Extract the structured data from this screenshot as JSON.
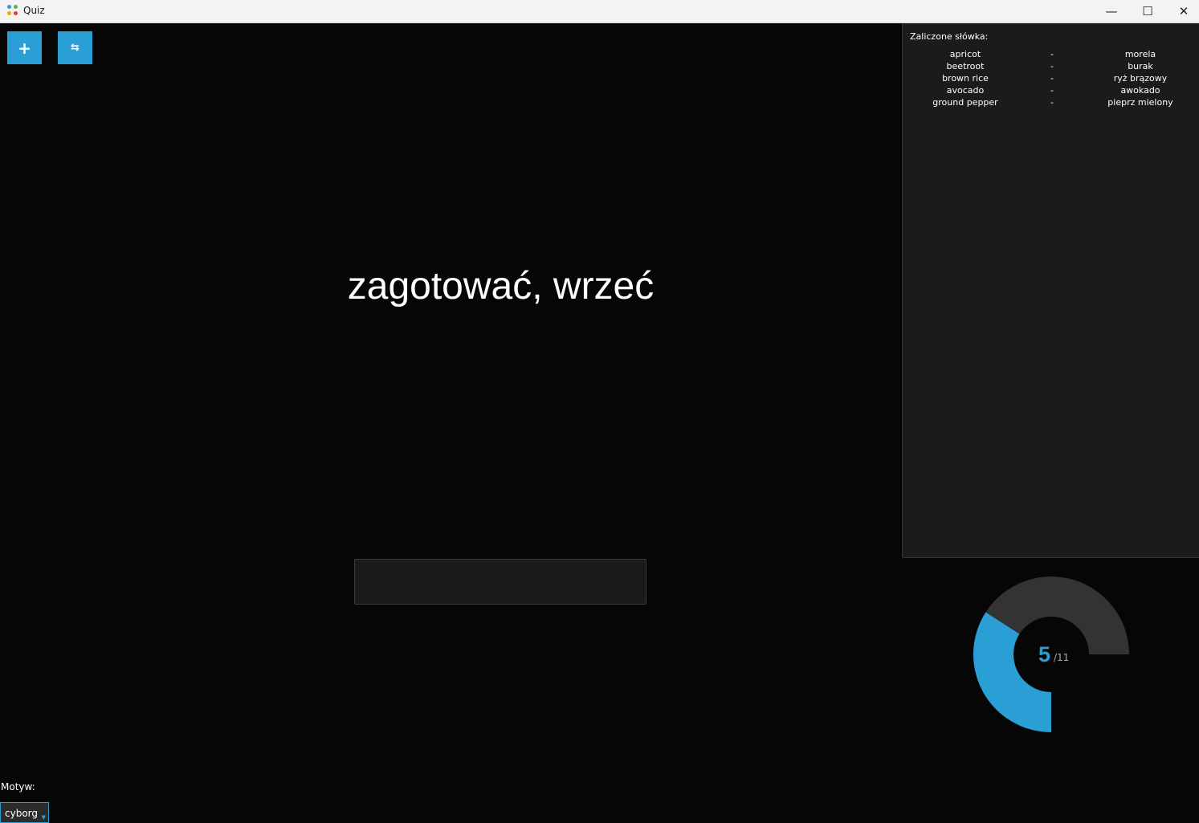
{
  "window": {
    "title": "Quiz",
    "icon": "app-dots-icon",
    "controls": {
      "minimize": "—",
      "maximize": "☐",
      "close": "✕"
    }
  },
  "toolbar": {
    "add_icon": "+",
    "swap_icon": "⇆"
  },
  "quiz": {
    "current_word": "zagotować, wrzeć",
    "answer_value": ""
  },
  "completed": {
    "title": "Zaliczone słówka:",
    "rows": [
      {
        "en": "apricot",
        "sep": "-",
        "pl": "morela"
      },
      {
        "en": "beetroot",
        "sep": "-",
        "pl": "burak"
      },
      {
        "en": "brown rice",
        "sep": "-",
        "pl": "ryż brązowy"
      },
      {
        "en": "avocado",
        "sep": "-",
        "pl": "awokado"
      },
      {
        "en": "ground pepper",
        "sep": "-",
        "pl": "pieprz mielony"
      }
    ]
  },
  "progress": {
    "done": "5",
    "total_label": "/11",
    "done_value": 5,
    "total_value": 11,
    "accent_color": "#2a9fd6",
    "track_color": "#333333"
  },
  "theme": {
    "label": "Motyw:",
    "selected": "cyborg"
  }
}
